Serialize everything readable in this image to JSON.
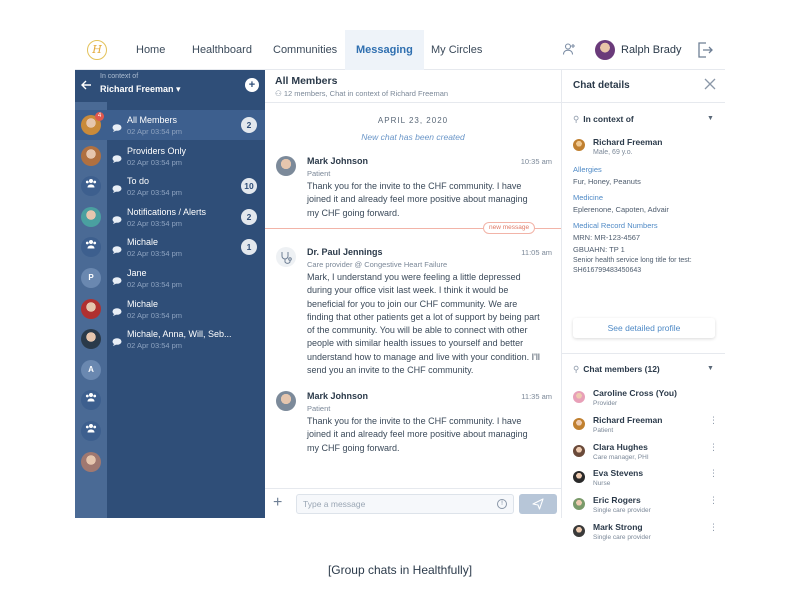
{
  "nav": {
    "logo": "H",
    "items": [
      "Home",
      "Healthboard",
      "Communities",
      "Messaging",
      "My Circles"
    ],
    "active": "Messaging",
    "user_name": "Ralph Brady",
    "colors": {
      "accent": "#2f6fb0",
      "sidebar": "#2f4e78",
      "rail": "#4a6a95"
    }
  },
  "sidebar": {
    "context_small": "In context of",
    "context_name": "Richard Freeman ▾",
    "chats": [
      {
        "title": "All Members",
        "date": "02 Apr 03:54 pm",
        "badge": "2",
        "rail": "avatar",
        "selected": true,
        "rail_badge": "4"
      },
      {
        "title": "Providers Only",
        "date": "02 Apr 03:54 pm",
        "badge": "",
        "rail": "avatar"
      },
      {
        "title": "To do",
        "date": "02 Apr 03:54 pm",
        "badge": "10",
        "rail": "group-icon"
      },
      {
        "title": "Notifications / Alerts",
        "date": "02 Apr 03:54 pm",
        "badge": "2",
        "rail": "avatar"
      },
      {
        "title": "Michale",
        "date": "02 Apr 03:54 pm",
        "badge": "1",
        "rail": "group-icon"
      },
      {
        "title": "Jane",
        "date": "02 Apr 03:54 pm",
        "badge": "",
        "rail": "P"
      },
      {
        "title": "Michale",
        "date": "02 Apr 03:54 pm",
        "badge": "",
        "rail": "avatar"
      },
      {
        "title": "Michale, Anna, Will, Seb...",
        "date": "02 Apr 03:54 pm",
        "badge": "",
        "rail": "avatar"
      }
    ],
    "extra_rail": [
      "A",
      "group-icon",
      "group-icon",
      "avatar"
    ]
  },
  "chat": {
    "title": "All Members",
    "subtitle": "12 members, Chat in context of Richard Freeman",
    "day": "APRIL 23, 2020",
    "created": "New chat has been created",
    "new_message_tag": "new message",
    "messages": [
      {
        "name": "Mark Johnson",
        "role": "Patient",
        "time": "10:35 am",
        "text": "Thank you for the invite to the CHF community. I have joined it and already feel more positive about managing my CHF going forward."
      },
      {
        "name": "Dr. Paul Jennings",
        "role": "Care provider @ Congestive Heart Failure",
        "time": "11:05 am",
        "text": "Mark, I understand you were feeling a little depressed during your office visit last week. I think it would be beneficial for you to join our CHF community. We are finding that other patients get a lot of support by being part of the community. You will be able to connect with other people with similar health issues to yourself and better understand how to manage and live with your condition.  I'll send you an invite to the CHF community."
      },
      {
        "name": "Mark Johnson",
        "role": "Patient",
        "time": "11:35 am",
        "text": "Thank you for the invite to the CHF community. I have joined it and already feel more positive about managing my CHF going forward."
      }
    ],
    "composer_placeholder": "Type a message"
  },
  "details": {
    "title": "Chat details",
    "context_header": "In context of",
    "patient_name": "Richard Freeman",
    "patient_meta": "Male, 69 y.o.",
    "allergies_label": "Allergies",
    "allergies": "Fur, Honey, Peanuts",
    "medicine_label": "Medicine",
    "medicine": "Eplerenone, Capoten, Advair",
    "mrn_label": "Medical Record Numbers",
    "mrn": "MRN: MR-123-4567",
    "gbuahn": "GBUAHN: TP 1",
    "senior_long": "Senior health service long title for test:",
    "senior_id": "SH616799483450643",
    "profile_button": "See detailed profile",
    "members_header": "Chat members (12)",
    "members": [
      {
        "name": "Caroline Cross (You)",
        "role": "Provider"
      },
      {
        "name": "Richard Freeman",
        "role": "Patient"
      },
      {
        "name": "Clara Hughes",
        "role": "Care manager, PHI"
      },
      {
        "name": "Eva Stevens",
        "role": "Nurse"
      },
      {
        "name": "Eric Rogers",
        "role": "Single care provider"
      },
      {
        "name": "Mark Strong",
        "role": "Single care provider"
      }
    ]
  },
  "caption": "[Group chats in Healthfully]"
}
